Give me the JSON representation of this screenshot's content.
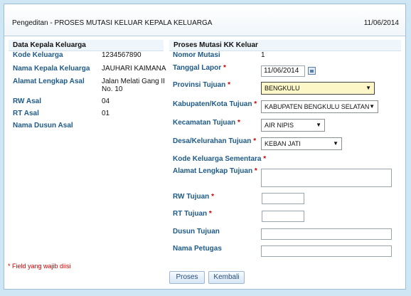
{
  "header": {
    "title": "Pengeditan - PROSES MUTASI KELUAR KEPALA KELUARGA",
    "date": "11/06/2014"
  },
  "left": {
    "section_title": "Data Kepala Keluarga",
    "fields": [
      {
        "label": "Kode Keluarga",
        "value": "1234567890"
      },
      {
        "label": "Nama Kepala Keluarga",
        "value": "JAUHARI KAIMANA"
      },
      {
        "label": "Alamat Lengkap Asal",
        "value_line1": "Jalan Melati Gang II",
        "value_line2": "No. 10"
      },
      {
        "label": "RW Asal",
        "value": "04"
      },
      {
        "label": "RT Asal",
        "value": "01"
      },
      {
        "label": "Nama Dusun Asal",
        "value": ""
      }
    ]
  },
  "right": {
    "section_title": "Proses Mutasi KK Keluar",
    "nomor_mutasi": {
      "label": "Nomor Mutasi",
      "value": "1"
    },
    "tanggal_lapor": {
      "label": "Tanggal Lapor",
      "value": "11/06/2014"
    },
    "provinsi": {
      "label": "Provinsi Tujuan",
      "value": "BENGKULU"
    },
    "kabupaten": {
      "label": "Kabupaten/Kota Tujuan",
      "value": "KABUPATEN BENGKULU SELATAN"
    },
    "kecamatan": {
      "label": "Kecamatan Tujuan",
      "value": "AIR NIPIS"
    },
    "desa": {
      "label": "Desa/Kelurahan Tujuan",
      "value": "KEBAN JATI"
    },
    "kode_sementara": {
      "label": "Kode Keluarga Sementara"
    },
    "alamat": {
      "label": "Alamat Lengkap Tujuan",
      "value": ""
    },
    "rw": {
      "label": "RW Tujuan",
      "value": ""
    },
    "rt": {
      "label": "RT Tujuan",
      "value": ""
    },
    "dusun": {
      "label": "Dusun Tujuan",
      "value": ""
    },
    "petugas": {
      "label": "Nama Petugas",
      "value": ""
    }
  },
  "required_marker": "*",
  "footer": {
    "note": "* Field yang wajib diisi",
    "proses_label": "Proses",
    "kembali_label": "Kembali"
  }
}
